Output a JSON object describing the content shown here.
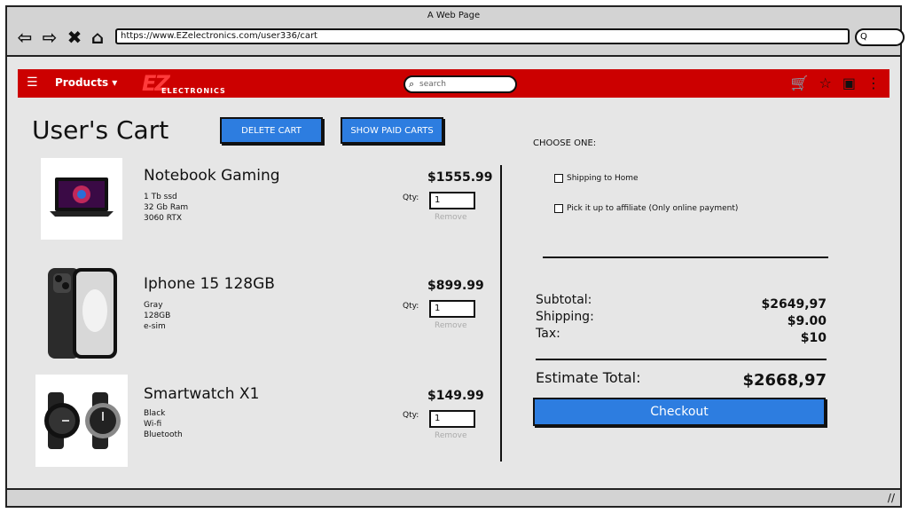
{
  "browser": {
    "window_title": "A Web Page",
    "url": "https://www.EZelectronics.com/user336/cart",
    "search_glyph": "Q",
    "nav_icons": [
      "back-arrow-icon",
      "forward-arrow-icon",
      "close-icon",
      "home-icon"
    ]
  },
  "navbar": {
    "products_label": "Products",
    "logo_brand": "EZ",
    "logo_text": "ELECTRONICS",
    "search_placeholder": "search",
    "icons": [
      "cart-icon",
      "star-icon",
      "user-icon",
      "kebab-icon"
    ]
  },
  "page": {
    "title": "User's Cart",
    "delete_cart_label": "DELETE CART",
    "show_paid_carts_label": "SHOW PAID CARTS"
  },
  "items": [
    {
      "name": "Notebook Gaming",
      "specs": [
        "1 Tb ssd",
        "32 Gb Ram",
        "3060 RTX"
      ],
      "price": "$1555.99",
      "qty_label": "Qty:",
      "qty": "1",
      "remove_label": "Remove"
    },
    {
      "name": "Iphone 15 128GB",
      "specs": [
        "Gray",
        "128GB",
        "e-sim"
      ],
      "price": "$899.99",
      "qty_label": "Qty:",
      "qty": "1",
      "remove_label": "Remove"
    },
    {
      "name": "Smartwatch X1",
      "specs": [
        "Black",
        "Wi-fi",
        "Bluetooth"
      ],
      "price": "$149.99",
      "qty_label": "Qty:",
      "qty": "1",
      "remove_label": "Remove"
    }
  ],
  "checkout": {
    "choose_label": "CHOOSE ONE:",
    "options": [
      "Shipping to Home",
      "Pick it up to affiliate (Only online payment)"
    ],
    "subtotal_label": "Subtotal:",
    "subtotal_value": "$2649,97",
    "shipping_label": "Shipping:",
    "shipping_value": "$9.00",
    "tax_label": "Tax:",
    "tax_value": "$10",
    "estimate_label": "Estimate Total:",
    "estimate_value": "$2668,97",
    "checkout_label": "Checkout"
  },
  "colors": {
    "brand_red": "#cc0000",
    "button_blue": "#2d7de0"
  }
}
